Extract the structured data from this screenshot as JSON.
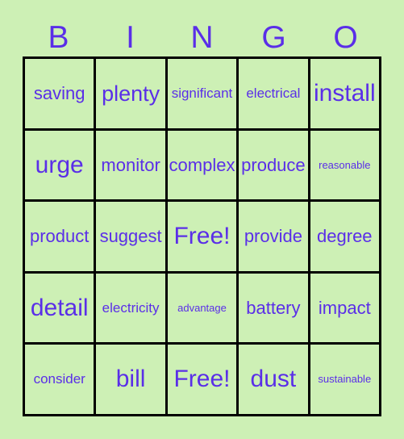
{
  "card": {
    "title": "BINGO",
    "background_color": "#cdf0b5",
    "text_color": "#5a2ee8",
    "grid_line_color": "#000000",
    "headers": [
      {
        "label": "B"
      },
      {
        "label": "I"
      },
      {
        "label": "N"
      },
      {
        "label": "G"
      },
      {
        "label": "O"
      }
    ],
    "rows": [
      [
        {
          "label": "saving",
          "size": "s-md"
        },
        {
          "label": "plenty",
          "size": "s-lg"
        },
        {
          "label": "significant",
          "size": "s-sm"
        },
        {
          "label": "electrical",
          "size": "s-sm"
        },
        {
          "label": "install",
          "size": "s-xl"
        }
      ],
      [
        {
          "label": "urge",
          "size": "s-xl"
        },
        {
          "label": "monitor",
          "size": "s-md"
        },
        {
          "label": "complex",
          "size": "s-md"
        },
        {
          "label": "produce",
          "size": "s-md"
        },
        {
          "label": "reasonable",
          "size": "s-xs"
        }
      ],
      [
        {
          "label": "product",
          "size": "s-md"
        },
        {
          "label": "suggest",
          "size": "s-md"
        },
        {
          "label": "Free!",
          "size": "s-xl"
        },
        {
          "label": "provide",
          "size": "s-md"
        },
        {
          "label": "degree",
          "size": "s-md"
        }
      ],
      [
        {
          "label": "detail",
          "size": "s-xl"
        },
        {
          "label": "electricity",
          "size": "s-sm"
        },
        {
          "label": "advantage",
          "size": "s-xs"
        },
        {
          "label": "battery",
          "size": "s-md"
        },
        {
          "label": "impact",
          "size": "s-md"
        }
      ],
      [
        {
          "label": "consider",
          "size": "s-sm"
        },
        {
          "label": "bill",
          "size": "s-xl"
        },
        {
          "label": "Free!",
          "size": "s-xl"
        },
        {
          "label": "dust",
          "size": "s-xl"
        },
        {
          "label": "sustainable",
          "size": "s-xs"
        }
      ]
    ]
  }
}
